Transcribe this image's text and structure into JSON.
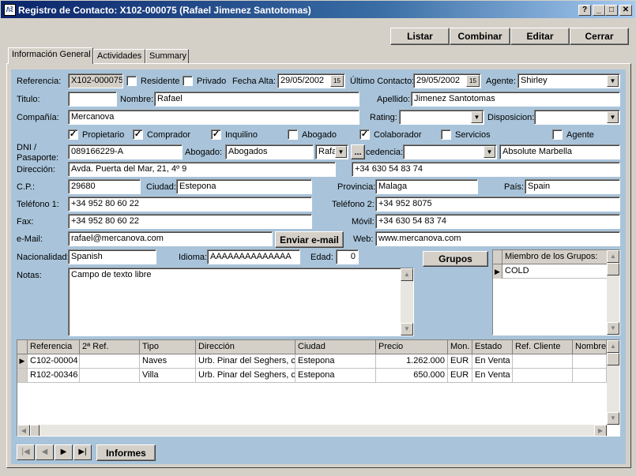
{
  "window": {
    "title": "Registro de Contacto: X102-000075 (Rafael Jimenez Santotomas)",
    "help": "?",
    "min": "_",
    "max": "□",
    "close": "✕",
    "app_icon": "ﾊﾐ"
  },
  "toolbar": {
    "listar": "Listar",
    "combinar": "Combinar",
    "editar": "Editar",
    "cerrar": "Cerrar"
  },
  "tabs": [
    "Información General",
    "Actividades",
    "Summary"
  ],
  "form": {
    "referencia_label": "Referencia:",
    "referencia": "X102-000075",
    "residente_label": "Residente",
    "privado_label": "Privado",
    "fecha_alta_label": "Fecha Alta:",
    "fecha_alta": "29/05/2002",
    "ultimo_contacto_label": "Último Contacto:",
    "ultimo_contacto": "29/05/2002",
    "cal_icon_label": "15",
    "agente_label": "Agente:",
    "agente": "Shirley",
    "titulo_label": "Titulo:",
    "titulo": "",
    "nombre_label": "Nombre:",
    "nombre": "Rafael",
    "apellido_label": "Apellido:",
    "apellido": "Jimenez Santotomas",
    "compania_label": "Compañía:",
    "compania": "Mercanova",
    "rating_label": "Rating:",
    "disposicion_label": "Disposicion:",
    "checks": {
      "propietario": "Propietario",
      "comprador": "Comprador",
      "inquilino": "Inquilino",
      "abogado": "Abogado",
      "colaborador": "Colaborador",
      "servicios": "Servicios",
      "agente": "Agente"
    },
    "dni_label_1": "DNI /",
    "dni_label_2": "Pasaporte:",
    "dni": "089166229-A",
    "abogado_label": "Abogado:",
    "abogado": "Abogados",
    "abogado_2": "Rafa",
    "ellipsis": "...",
    "procedencia_label": "cedencia:",
    "procedencia_2": "Absolute Marbella",
    "direccion_label": "Dirección:",
    "direccion": "Avda. Puerta del Mar, 21, 4º 9",
    "movil_top": "+34 630 54 83 74",
    "cp_label": "C.P.:",
    "cp": "29680",
    "ciudad_label": "Ciudad:",
    "ciudad": "Estepona",
    "provincia_label": "Provincia:",
    "provincia": "Malaga",
    "pais_label": "País:",
    "pais": "Spain",
    "telefono1_label": "Teléfono 1:",
    "telefono1": "+34 952 80 60 22",
    "telefono2_label": "Teléfono 2:",
    "telefono2": "+34 952 8075",
    "fax_label": "Fax:",
    "fax": "+34 952 80 60 22",
    "movil_label": "Móvil:",
    "movil": "+34 630 54 83 74",
    "email_label": "e-Mail:",
    "email": "rafael@mercanova.com",
    "enviar_email": "Enviar e-mail",
    "web_label": "Web:",
    "web": "www.mercanova.com",
    "nacionalidad_label": "Nacionalidad:",
    "nacionalidad": "Spanish",
    "idioma_label": "Idioma:",
    "idioma": "AAAAAAAAAAAAAA",
    "edad_label": "Edad:",
    "edad": "0",
    "grupos_button": "Grupos",
    "miembro_header": "Miembro de los Grupos:",
    "miembro_items": [
      "COLD"
    ],
    "notas_label": "Notas:",
    "notas": "Campo de texto libre"
  },
  "grid": {
    "columns": [
      "Referencia",
      "2ª Ref.",
      "Tipo",
      "Dirección",
      "Ciudad",
      "Precio",
      "Mon.",
      "Estado",
      "Ref. Cliente",
      "Nombre"
    ],
    "rows": [
      [
        "C102-00004",
        "",
        "Naves",
        "Urb. Pinar del Seghers, ca",
        "Estepona",
        "1.262.000",
        "EUR",
        "En Venta",
        "",
        ""
      ],
      [
        "R102-00346",
        "",
        "Villa",
        "Urb. Pinar del Seghers, ca",
        "Estepona",
        "650.000",
        "EUR",
        "En Venta",
        "",
        ""
      ]
    ]
  },
  "footer": {
    "informes": "Informes",
    "nav_first": "|◀",
    "nav_prev": "◀",
    "nav_next": "▶",
    "nav_last": "▶|"
  }
}
